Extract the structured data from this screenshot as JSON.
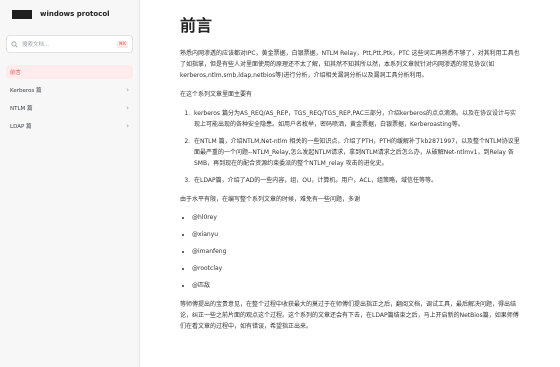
{
  "sidebar": {
    "brand": "windows protocol",
    "search_placeholder": "搜索文档...",
    "search_shortcut": "⌘K",
    "items": [
      {
        "label": "前言"
      },
      {
        "label": "Kerberos 篇"
      },
      {
        "label": "NTLM 篇"
      },
      {
        "label": "LDAP 篇"
      }
    ]
  },
  "main": {
    "title": "前言",
    "intro": "熟悉内网渗透的应该都对IPC，黄金票据，白银票据，NTLM Relay，Ptt,Ptt,Ptk，PTC 这些词汇再熟悉不够了，对其利用工具也了如指掌，但是有些人对里面使用的原理还不太了解，知其然不知其所以然，本系列文章就针对内网渗透的常见协议(如kerberos,ntlm,smb,ldap,netbios等)进行分析，介绍相关漏洞分析以及漏洞工具分析利用。",
    "series_title": "在这个系列文章里面主要有",
    "list": [
      "kerberos 篇分为AS_REQ/AS_REP，TGS_REQ/TGS_REP,PAC三部分，介绍kerberos的点点滴滴。以及在协议设计与实现上可能出现的各种安全隐患。如用户名枚举，密码喷洒，黄金票据，白银票据，Kerberoasting等。",
      "在NTLM 篇，介绍NTLM,Net-ntlm 相关的一些知识点，介绍了PTH，PTH的缓解补丁kb2871997，以及整个NTLM协议里面最严重的一个问题--NTLM_Relay,怎么发起NTLM请求，拿到NTLM请求之后怎么办，从破解Net-ntlmv1，到Relay 各SMB，再到现在的配合资源约束委派的整个NTLM_relay 攻击的进化史。",
      "在LDAP篇，介绍了AD的一些内容，组，OU，计算机，用户，ACL，组策略，域信任等等。"
    ],
    "thanks_intro": "由于水平有限，在编写整个系列文章的时候，难免有一些问题，多谢",
    "thanks": [
      "@hl0rey",
      "@xianyu",
      "@imanfeng",
      "@rootclay",
      "@匹敌"
    ],
    "closing": "等师傅提出的宝贵意见，在整个过程中收获最大的莫过于在师傅们提出指正之后，翻阅文档，调试工具，最后解决问题，得出结论，纠正一些之前片面的观点这个过程。这个系列的文章还会有下去，在LDAP篇结束之后，马上开启新的NetBios篇，如果师傅们在看文章的过程中，如有错误，希望指正出来。"
  }
}
